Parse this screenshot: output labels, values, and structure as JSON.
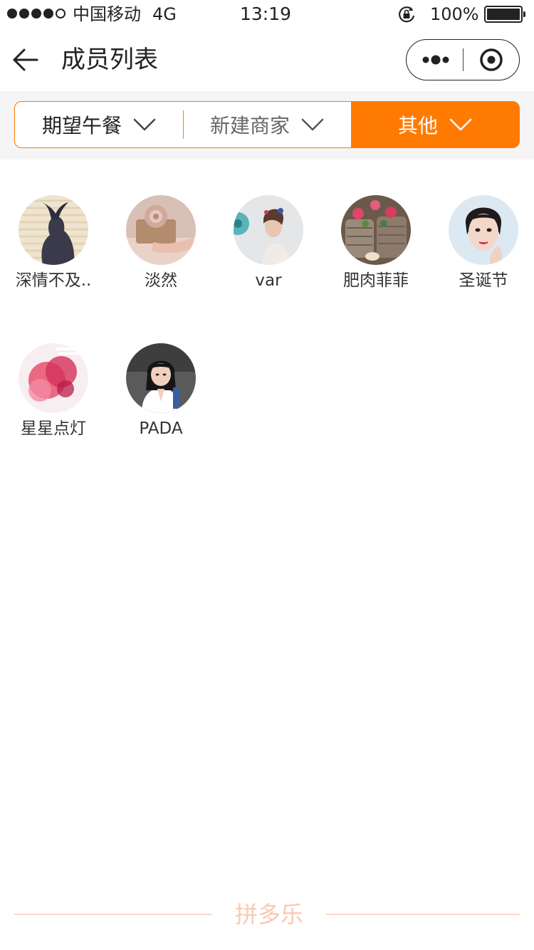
{
  "status_bar": {
    "carrier": "中国移动",
    "network": "4G",
    "time": "13:19",
    "battery_percent": "100%",
    "signal_strength": "4 of 5",
    "battery_level": 1.0
  },
  "nav": {
    "title": "成员列表",
    "back_icon": "arrow-left-icon",
    "more_icon": "more-dots-icon",
    "close_icon": "target-circle-icon"
  },
  "filters": {
    "tabs": [
      {
        "label": "期望午餐",
        "active": false
      },
      {
        "label": "新建商家",
        "active": false
      },
      {
        "label": "其他",
        "active": true
      }
    ],
    "accent_color": "#ff7a00"
  },
  "members": [
    {
      "name": "深情不及.."
    },
    {
      "name": "淡然"
    },
    {
      "name": "var"
    },
    {
      "name": "肥肉菲菲"
    },
    {
      "name": "圣诞节"
    },
    {
      "name": "星星点灯"
    },
    {
      "name": "PADA"
    }
  ],
  "footer": {
    "brand": "拼多乐"
  }
}
